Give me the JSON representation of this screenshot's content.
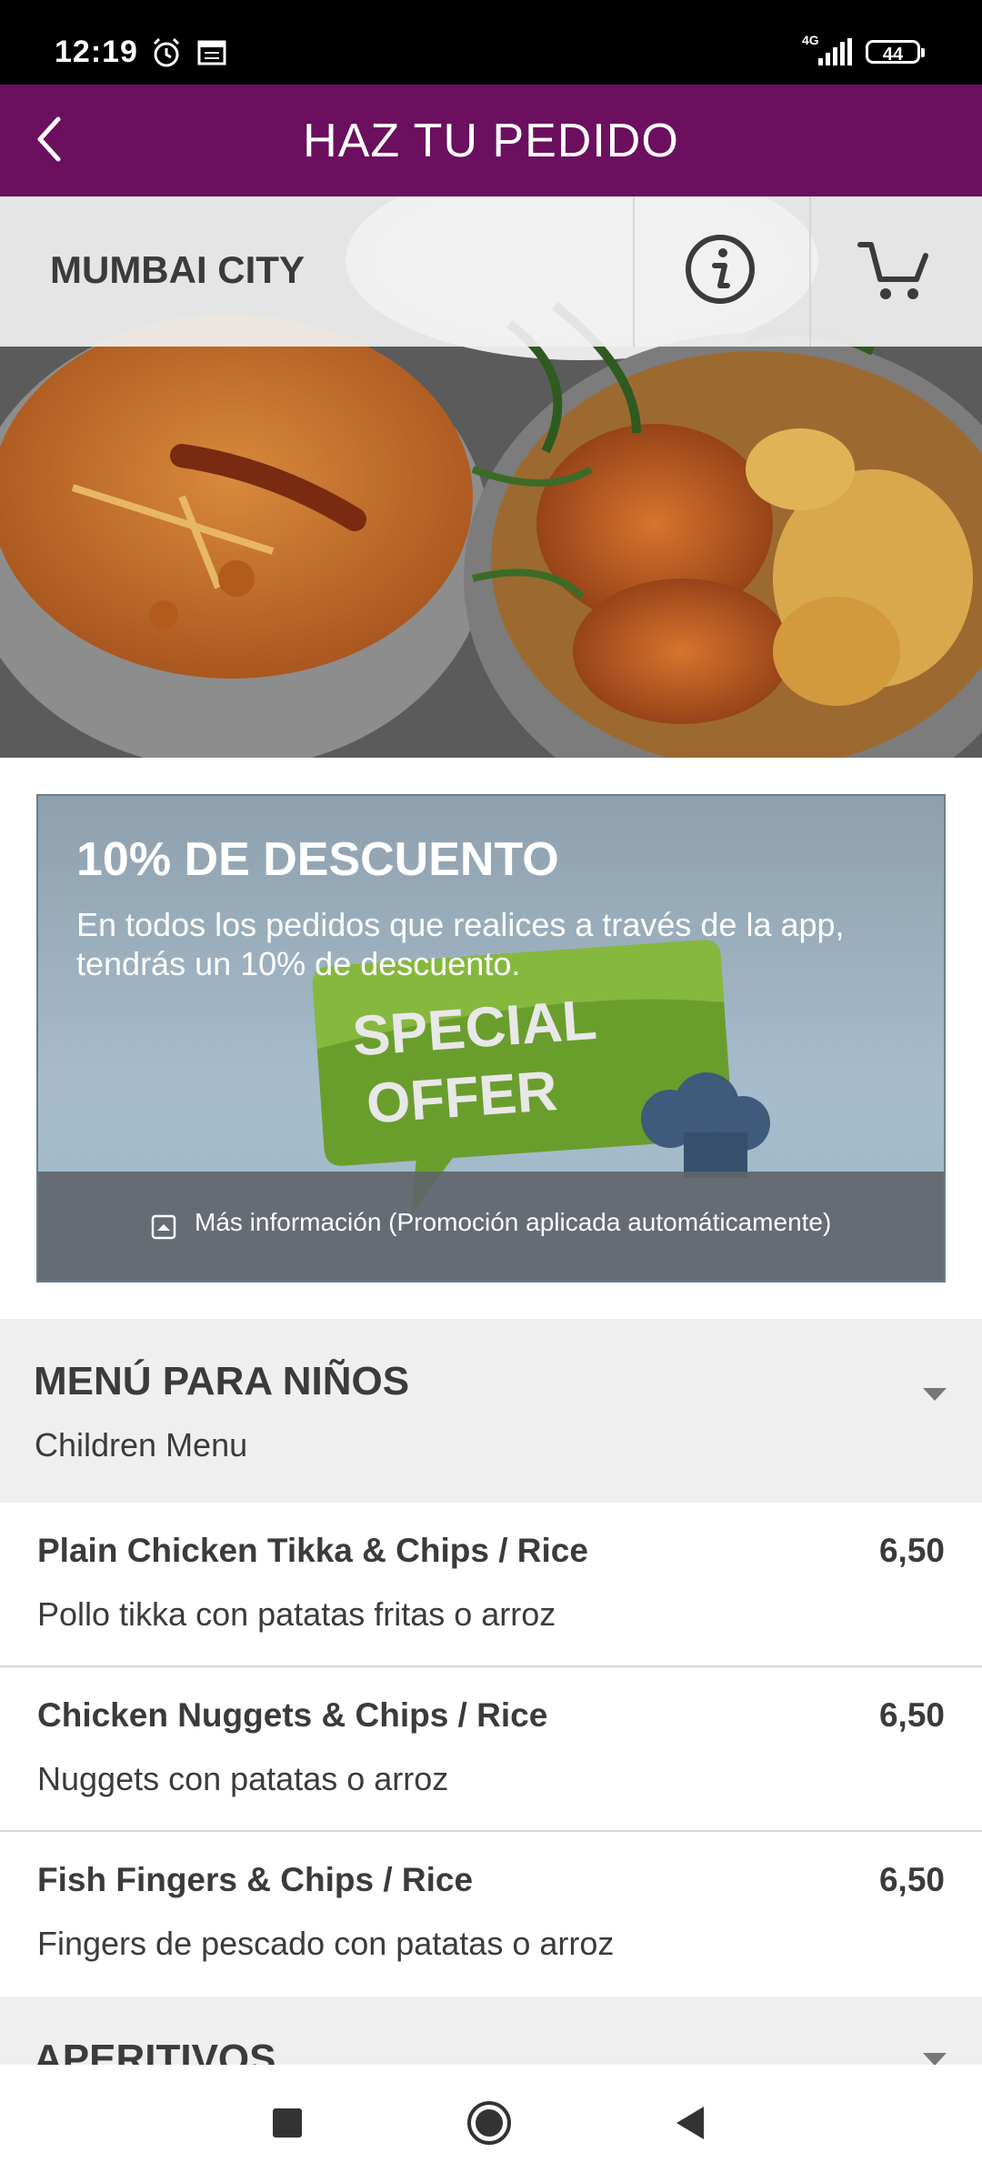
{
  "status_bar": {
    "time": "12:19",
    "network": "4G",
    "battery": "44"
  },
  "app_bar": {
    "title": "HAZ TU PEDIDO"
  },
  "restaurant": {
    "name": "MUMBAI CITY"
  },
  "promo": {
    "title": "10% DE DESCUENTO",
    "text": "En todos los pedidos que realices a través de la app, tendrás un 10% de descuento.",
    "graphic_line1": "SPECIAL",
    "graphic_line2": "OFFER",
    "more_info": "Más información (Promoción aplicada automáticamente)"
  },
  "categories": [
    {
      "title": "MENÚ PARA NIÑOS",
      "subtitle": "Children Menu",
      "items": [
        {
          "name": "Plain Chicken Tikka & Chips / Rice",
          "price": "6,50",
          "description": "Pollo tikka con patatas fritas o arroz"
        },
        {
          "name": "Chicken Nuggets & Chips / Rice",
          "price": "6,50",
          "description": "Nuggets con patatas o arroz"
        },
        {
          "name": "Fish Fingers & Chips / Rice",
          "price": "6,50",
          "description": "Fingers de pescado con patatas o arroz"
        }
      ]
    },
    {
      "title": "APERITIVOS"
    }
  ],
  "colors": {
    "app_bar": "#6b0f5e",
    "category_bg": "#efefef",
    "text": "#3b3b3b"
  }
}
